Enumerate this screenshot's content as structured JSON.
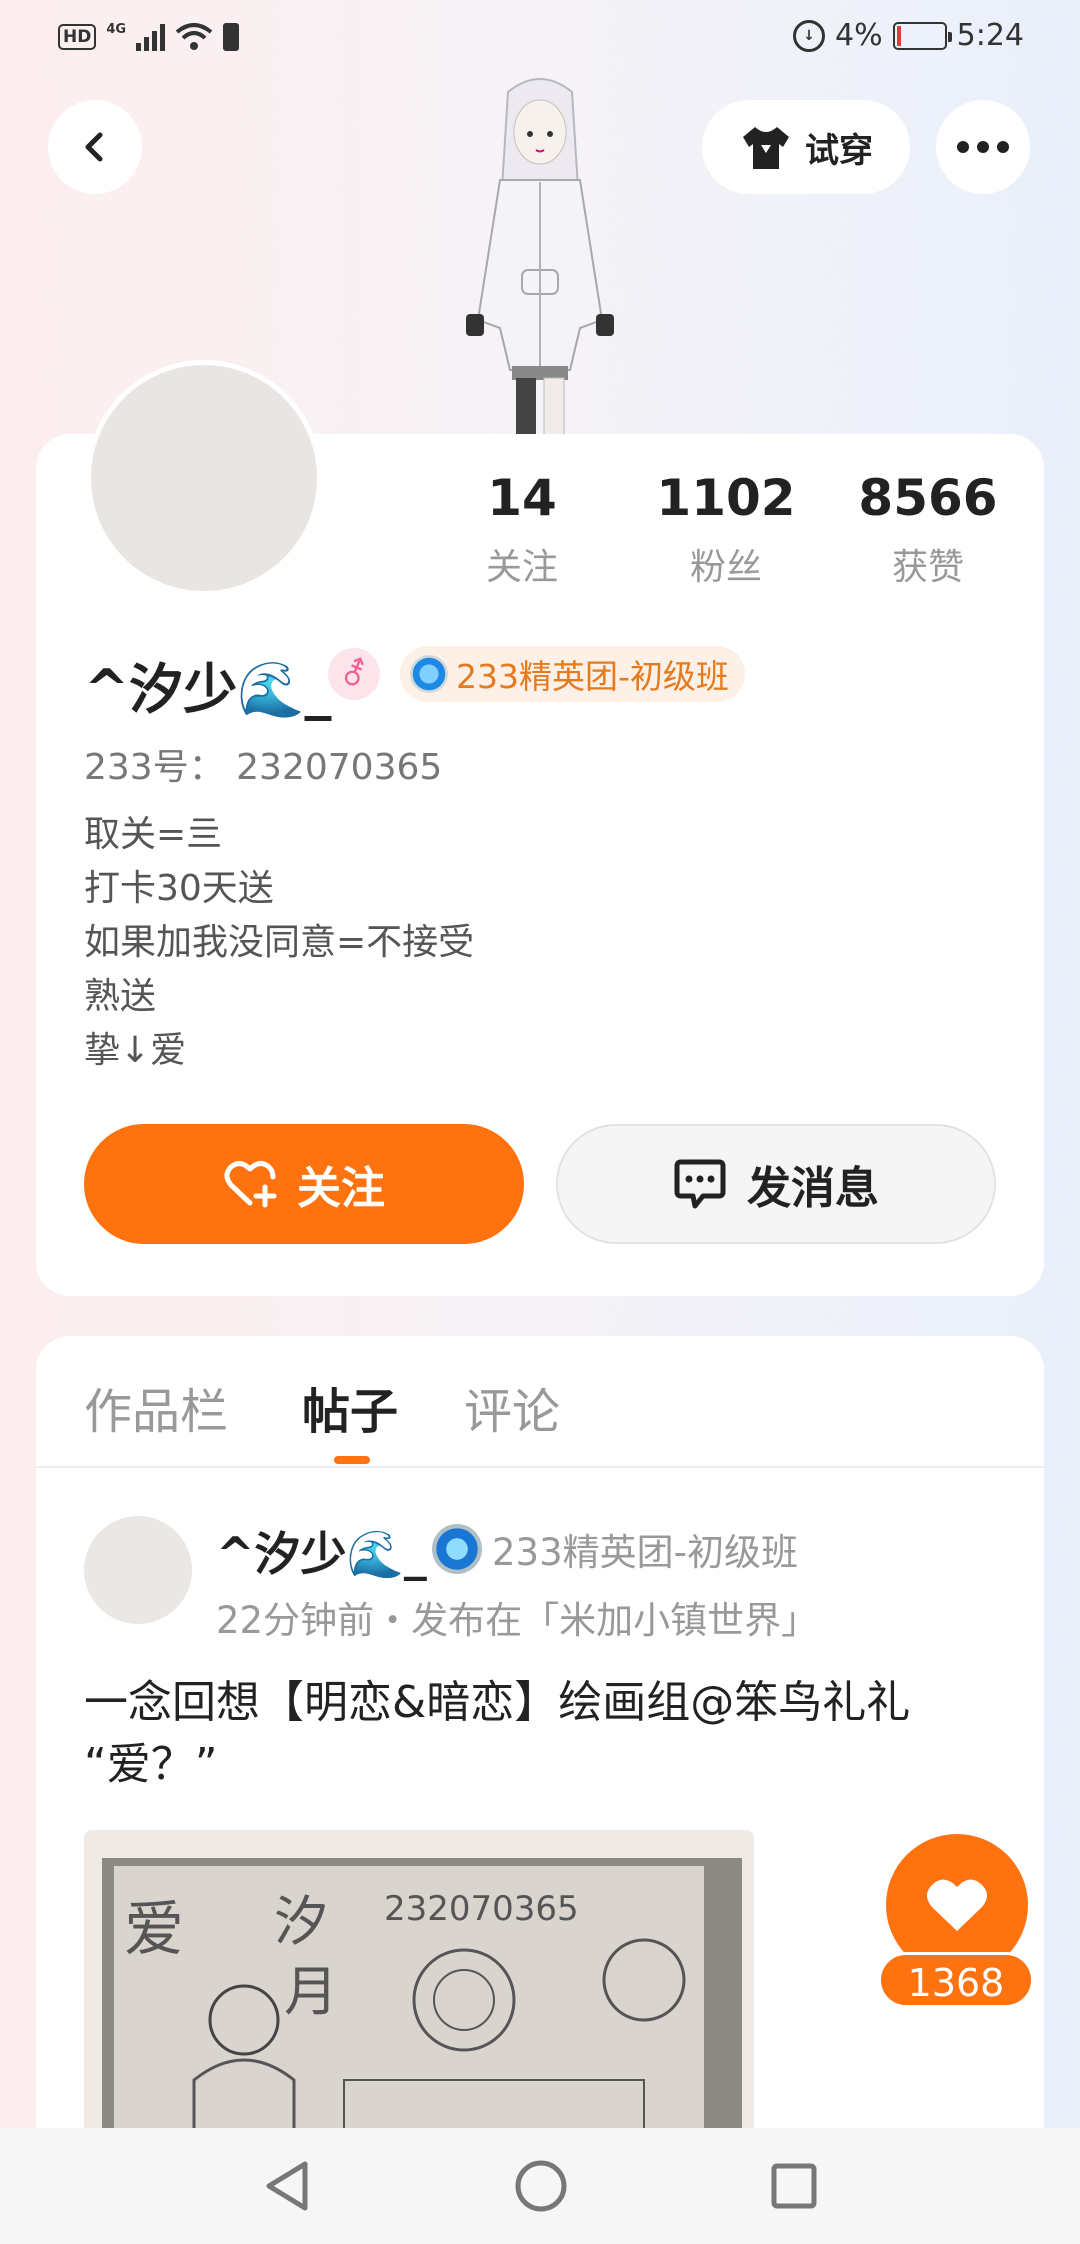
{
  "status_bar": {
    "hd": "HD",
    "network": "4G",
    "battery_percent": "4%",
    "time": "5:24"
  },
  "header": {
    "try_on_label": "试穿"
  },
  "profile": {
    "stats": [
      {
        "value": "14",
        "label": "关注"
      },
      {
        "value": "1102",
        "label": "粉丝"
      },
      {
        "value": "8566",
        "label": "获赞"
      }
    ],
    "name": "^汐少🌊_",
    "gender_symbol": "⚦",
    "badge": "233精英团-初级班",
    "uid": "233号： 232070365",
    "bio": [
      "取关=亖",
      "打卡30天送",
      "如果加我没同意=不接受",
      "熟送",
      "挚↓爱"
    ],
    "follow_label": "关注",
    "message_label": "发消息"
  },
  "tabs": [
    {
      "label": "作品栏"
    },
    {
      "label": "帖子"
    },
    {
      "label": "评论"
    }
  ],
  "post": {
    "author": "^汐少🌊_",
    "badge": "233精英团-初级班",
    "meta": "22分钟前・发布在「米加小镇世界」",
    "text_line1": "一念回想【明恋&暗恋】绘画组@笨鸟礼礼",
    "text_line2": "“爱？”",
    "sketch_number": "232070365",
    "sketch_name": "汐月",
    "like_count": "1368"
  },
  "colors": {
    "accent": "#ff7210",
    "badge_text": "#e57a1f"
  }
}
